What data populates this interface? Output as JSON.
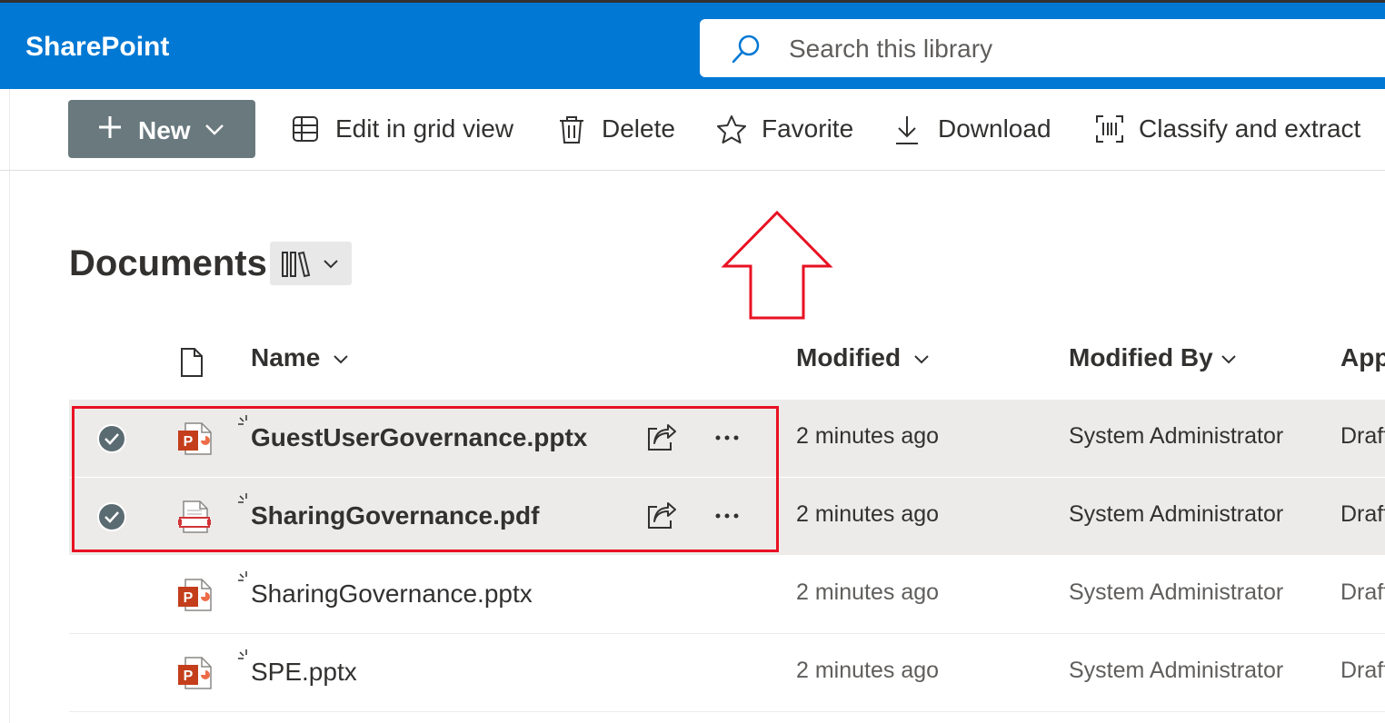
{
  "app": {
    "title": "SharePoint"
  },
  "search": {
    "placeholder": "Search this library"
  },
  "toolbar": {
    "new_label": "New",
    "edit_grid_label": "Edit in grid view",
    "delete_label": "Delete",
    "favorite_label": "Favorite",
    "download_label": "Download",
    "classify_label": "Classify and extract"
  },
  "library": {
    "title": "Documents"
  },
  "columns": {
    "name": "Name",
    "modified": "Modified",
    "modified_by": "Modified By",
    "approval": "App"
  },
  "files": [
    {
      "name": "GuestUserGovernance.pptx",
      "modified": "2 minutes ago",
      "modified_by": "System Administrator",
      "status": "Draft",
      "type": "pptx-icon",
      "selected": true
    },
    {
      "name": "SharingGovernance.pdf",
      "modified": "2 minutes ago",
      "modified_by": "System Administrator",
      "status": "Draft",
      "type": "pdf-icon",
      "selected": true
    },
    {
      "name": "SharingGovernance.pptx",
      "modified": "2 minutes ago",
      "modified_by": "System Administrator",
      "status": "Draft",
      "type": "pptx-icon",
      "selected": false
    },
    {
      "name": "SPE.pptx",
      "modified": "2 minutes ago",
      "modified_by": "System Administrator",
      "status": "Draft",
      "type": "pptx-icon",
      "selected": false
    }
  ],
  "colors": {
    "brand": "#0078d4",
    "new_button": "#69797e",
    "selection": "#edebe9",
    "annotation": "#e81123",
    "powerpoint": "#c43e1c"
  }
}
